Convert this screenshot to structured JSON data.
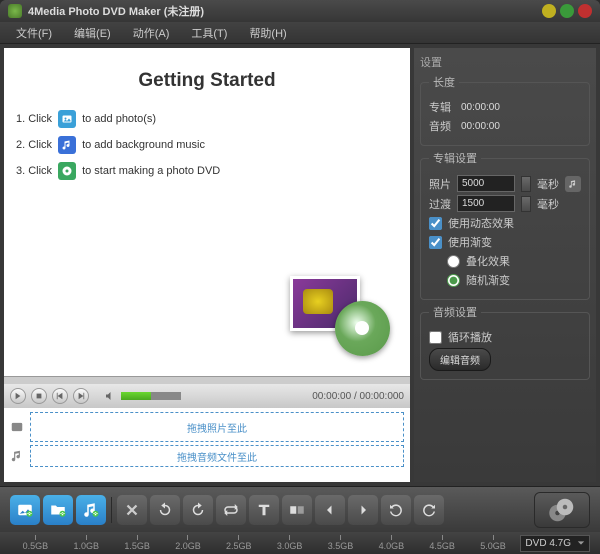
{
  "title": "4Media Photo DVD Maker (未注册)",
  "menu": {
    "file": "文件(F)",
    "edit": "编辑(E)",
    "action": "动作(A)",
    "tools": "工具(T)",
    "help": "帮助(H)"
  },
  "preview": {
    "heading": "Getting Started",
    "step1_pre": "1. Click",
    "step1_post": "to add photo(s)",
    "step2_pre": "2. Click",
    "step2_post": "to add background music",
    "step3_pre": "3. Click",
    "step3_post": "to start making a photo DVD"
  },
  "playback": {
    "time": "00:00:00 / 00:00:000"
  },
  "tracks": {
    "photo_hint": "拖拽照片至此",
    "audio_hint": "拖拽音频文件至此"
  },
  "settings": {
    "header": "设置",
    "length": {
      "label": "长度",
      "album_label": "专辑",
      "album_value": "00:00:00",
      "audio_label": "音频",
      "audio_value": "00:00:00"
    },
    "album": {
      "legend": "专辑设置",
      "photo_label": "照片",
      "photo_value": "5000",
      "photo_unit": "毫秒",
      "transition_label": "过渡",
      "transition_value": "1500",
      "transition_unit": "毫秒",
      "motion": "使用动态效果",
      "gradient": "使用渐变",
      "overlay": "叠化效果",
      "random": "随机渐变"
    },
    "audio": {
      "legend": "音频设置",
      "loop": "循环播放",
      "edit_btn": "编辑音频"
    }
  },
  "status": {
    "ticks": [
      "0.5GB",
      "1.0GB",
      "1.5GB",
      "2.0GB",
      "2.5GB",
      "3.0GB",
      "3.5GB",
      "4.0GB",
      "4.5GB",
      "5.0GB"
    ],
    "dvd": "DVD 4.7G"
  }
}
